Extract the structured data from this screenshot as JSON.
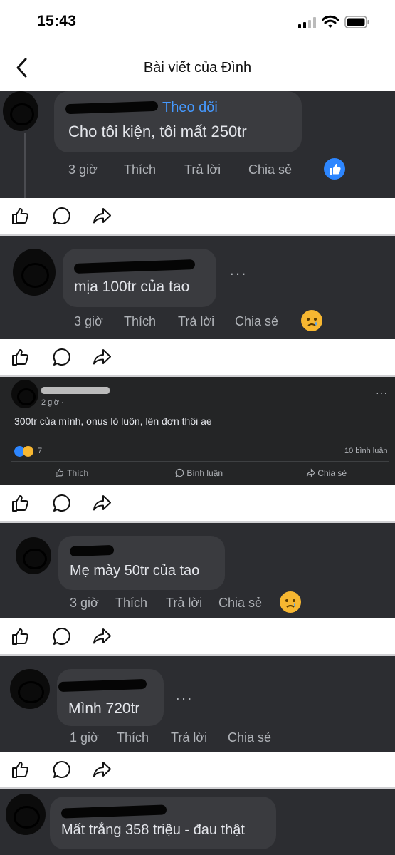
{
  "status_bar": {
    "time": "15:43"
  },
  "nav": {
    "title": "Bài viết của Đình"
  },
  "comments": [
    {
      "text": "Cho tôi kiện, tôi mất 250tr",
      "follow": "Theo dõi",
      "time": "3 giờ",
      "like": "Thích",
      "reply": "Trả lời",
      "share": "Chia sẻ",
      "reaction": "like"
    },
    {
      "text": "mịa 100tr của tao",
      "time": "3 giờ",
      "like": "Thích",
      "reply": "Trả lời",
      "share": "Chia sẻ",
      "reaction": "sad"
    },
    {
      "text": "Mẹ mày 50tr của tao",
      "time": "3 giờ",
      "like": "Thích",
      "reply": "Trả lời",
      "share": "Chia sẻ",
      "reaction": "sad"
    },
    {
      "text": "Mình 720tr",
      "time": "1 giờ",
      "like": "Thích",
      "reply": "Trả lời",
      "share": "Chia sẻ"
    },
    {
      "text": "Mất trắng 358 triệu - đau thật"
    }
  ],
  "post": {
    "time": "2 giờ ·",
    "text": "300tr của mình, onus lò luôn, lên đơn thôi ae",
    "reaction_count": "7",
    "comment_count": "10 bình luận",
    "like_label": "Thích",
    "comment_label": "Bình luận",
    "share_label": "Chia sẻ"
  },
  "colors": {
    "dark_bg": "#2c2d31",
    "bubble": "#3a3b3f",
    "follow": "#4599ff",
    "like_blue": "#2d86ff"
  }
}
